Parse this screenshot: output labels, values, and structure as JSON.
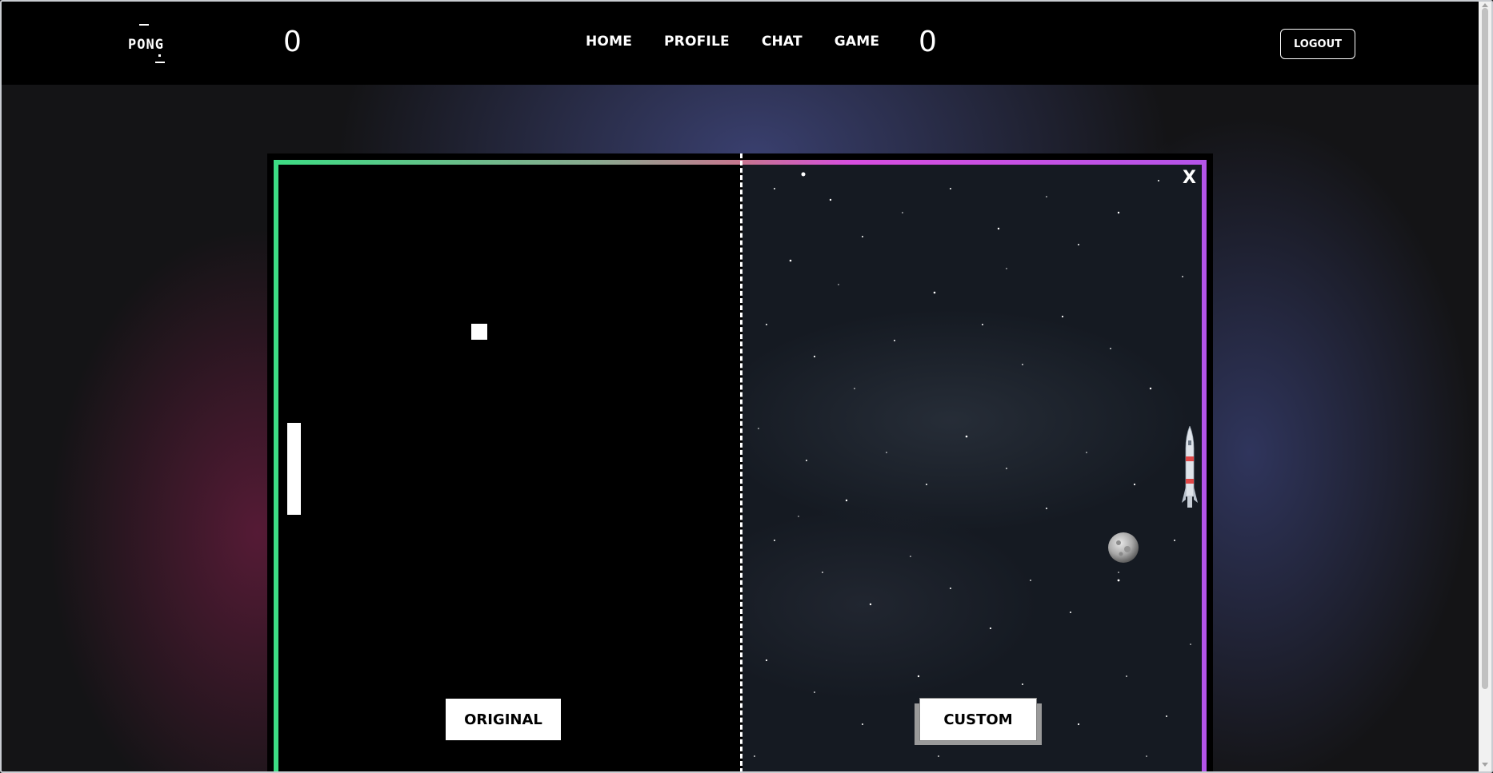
{
  "header": {
    "logo_text": "PONG",
    "nav": [
      "HOME",
      "PROFILE",
      "CHAT",
      "GAME"
    ],
    "logout_label": "LOGOUT"
  },
  "game": {
    "score_left": "0",
    "score_right": "0",
    "close_label": "X",
    "mode_original_label": "ORIGINAL",
    "mode_custom_label": "CUSTOM",
    "colors": {
      "left_border": "#3ddc84",
      "right_border": "#b454e8",
      "left_background": "#000000",
      "right_background": "starfield"
    },
    "icons": [
      "moon-icon",
      "rocket-paddle-icon"
    ]
  }
}
